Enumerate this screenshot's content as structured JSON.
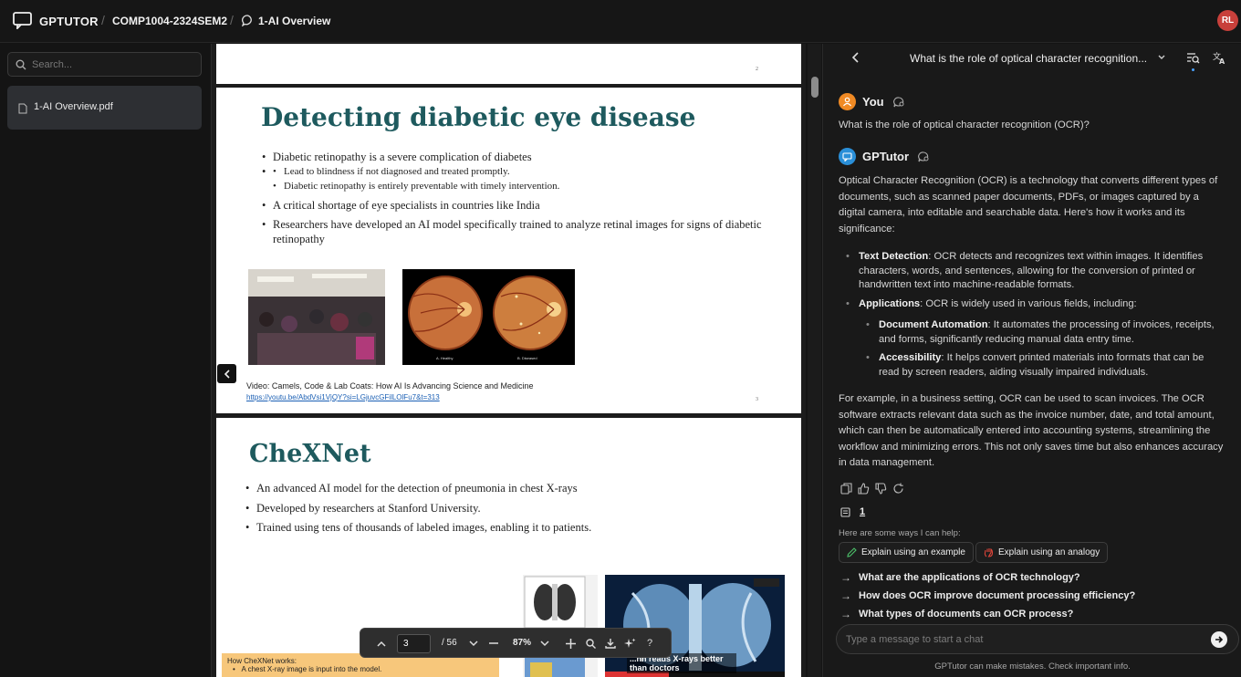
{
  "topbar": {
    "brand": "GPTUTOR",
    "course": "COMP1004-2324SEM2",
    "chat_name": "1-AI Overview",
    "separator": "/",
    "avatar_initials": "RL",
    "avatar_color": "#c8403b"
  },
  "sidebar": {
    "search_placeholder": "Search...",
    "files": [
      {
        "label": "1-AI Overview.pdf"
      }
    ]
  },
  "document": {
    "page1": {
      "number": "2"
    },
    "page2": {
      "title": "Detecting diabetic eye disease",
      "bullets": [
        "Diabetic retinopathy is a severe complication of  diabetes",
        "A critical shortage of  eye specialists in countries like India",
        "Researchers have developed an AI model specifically trained to analyze retinal images for signs of diabetic retinopathy"
      ],
      "sub_bullets": [
        "Lead to blindness if  not diagnosed and treated promptly.",
        "Diabetic retinopathy is entirely preventable with timely intervention."
      ],
      "image_labels": [
        "A. Healthy",
        "B. Diseased"
      ],
      "caption": "Video: Camels, Code & Lab Coats: How AI Is Advancing Science and Medicine",
      "link": "https://youtu.be/AbdVsi1VjQY?si=LGjuvcGFilLOlFu7&t=313",
      "number": "3"
    },
    "page3": {
      "title": "CheXNet",
      "bullets": [
        "An advanced AI model for the detection of  pneumonia in chest X-rays",
        "Developed by researchers at Stanford University.",
        "Trained using tens of  thousands of  labeled images, enabling it to patients."
      ],
      "video_overlay": "...nn reads X-rays better than doctors",
      "how_title": "How CheXNet works:",
      "how_item": "A chest X-ray image is input into the model."
    }
  },
  "pdf_toolbar": {
    "current_page": "3",
    "total_pages": "/ 56",
    "zoom": "87%"
  },
  "chat": {
    "title": "What is the role of optical character recognition...",
    "user_name": "You",
    "user_message": "What is the role of optical character recognition (OCR)?",
    "bot_name": "GPTutor",
    "intro": "Optical Character Recognition (OCR) is a technology that converts different types of documents, such as scanned paper documents, PDFs, or images captured by a digital camera, into editable and searchable data. Here's how it works and its significance:",
    "points": [
      {
        "term": "Text Detection",
        "text": ": OCR detects and recognizes text within images. It identifies characters, words, and sentences, allowing for the conversion of printed or handwritten text into machine-readable formats."
      },
      {
        "term": "Applications",
        "text": ": OCR is widely used in various fields, including:"
      }
    ],
    "subpoints": [
      {
        "term": "Document Automation",
        "text": ": It automates the processing of invoices, receipts, and forms, significantly reducing manual data entry time."
      },
      {
        "term": "Accessibility",
        "text": ": It helps convert printed materials into formats that can be read by screen readers, aiding visually impaired individuals."
      }
    ],
    "conclusion": "For example, in a business setting, OCR can be used to scan invoices. The OCR software extracts relevant data such as the invoice number, date, and total amount, which can then be automatically entered into accounting systems, streamlining the workflow and minimizing errors. This not only saves time but also enhances accuracy in data management.",
    "source_number": "1",
    "help_label": "Here are some ways I can help:",
    "chips": [
      "Explain using an example",
      "Explain using an analogy"
    ],
    "suggestions": [
      "What are the applications of OCR technology?",
      "How does OCR improve document processing efficiency?",
      "What types of documents can OCR process?"
    ],
    "input_placeholder": "Type a message to start a chat",
    "disclaimer": "GPTutor can make mistakes. Check important info.",
    "user_badge_color": "#f08a24",
    "bot_badge_color": "#2a8fd8"
  }
}
